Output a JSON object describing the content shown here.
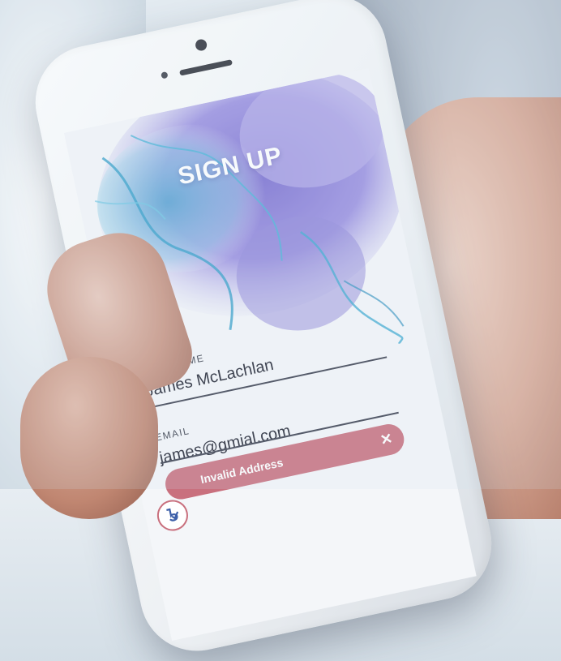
{
  "screen": {
    "title": "SIGN UP",
    "full_name": {
      "label": "FULL NAME",
      "value": "James McLachlan"
    },
    "email": {
      "label": "EMAIL",
      "value": "james@gmial.com"
    },
    "error": {
      "message": "Invalid Address",
      "close_icon": "close-icon"
    }
  },
  "colors": {
    "accent": "#c9707e",
    "ink_primary": "#8b7fd6",
    "ink_secondary": "#5fb6d6",
    "text_dark": "#1f2230"
  }
}
